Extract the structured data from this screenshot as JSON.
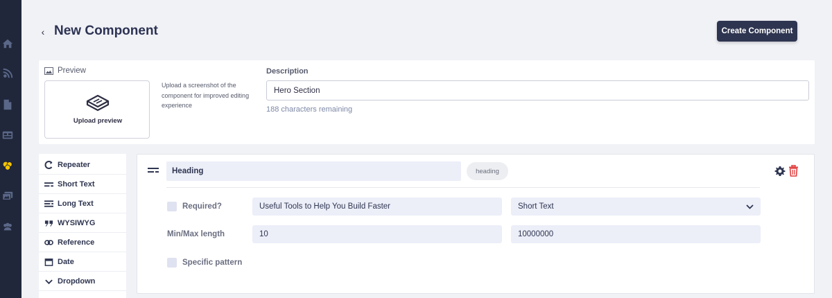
{
  "header": {
    "title": "New Component",
    "create_button": "Create Component"
  },
  "nav_rail": {
    "icons": [
      "home-icon",
      "blog-icon",
      "page-icon",
      "grid-icon",
      "components-icon",
      "media-icon",
      "users-icon"
    ],
    "active_color": "#f5c400"
  },
  "preview": {
    "label": "Preview",
    "upload_label": "Upload preview",
    "help_text": "Upload a screenshot of the component for improved editing experience"
  },
  "description": {
    "label": "Description",
    "value": "Hero Section",
    "remaining": "188 characters remaining"
  },
  "field_types": [
    {
      "label": "Repeater",
      "icon": "repeater-icon"
    },
    {
      "label": "Short Text",
      "icon": "short-text-icon"
    },
    {
      "label": "Long Text",
      "icon": "long-text-icon"
    },
    {
      "label": "WYSIWYG",
      "icon": "quote-icon"
    },
    {
      "label": "Reference",
      "icon": "link-icon"
    },
    {
      "label": "Date",
      "icon": "calendar-icon"
    },
    {
      "label": "Dropdown",
      "icon": "chevron-down-icon"
    }
  ],
  "field": {
    "name": "Heading",
    "key": "heading",
    "required_label": "Required?",
    "default_value": "Useful Tools to Help You Build Faster",
    "type": "Short Text",
    "minmax_label": "Min/Max length",
    "min": "10",
    "max": "10000000",
    "pattern_label": "Specific pattern"
  },
  "colors": {
    "rail_bg": "#20273a",
    "primary": "#2e3550",
    "danger": "#e03d3d"
  }
}
